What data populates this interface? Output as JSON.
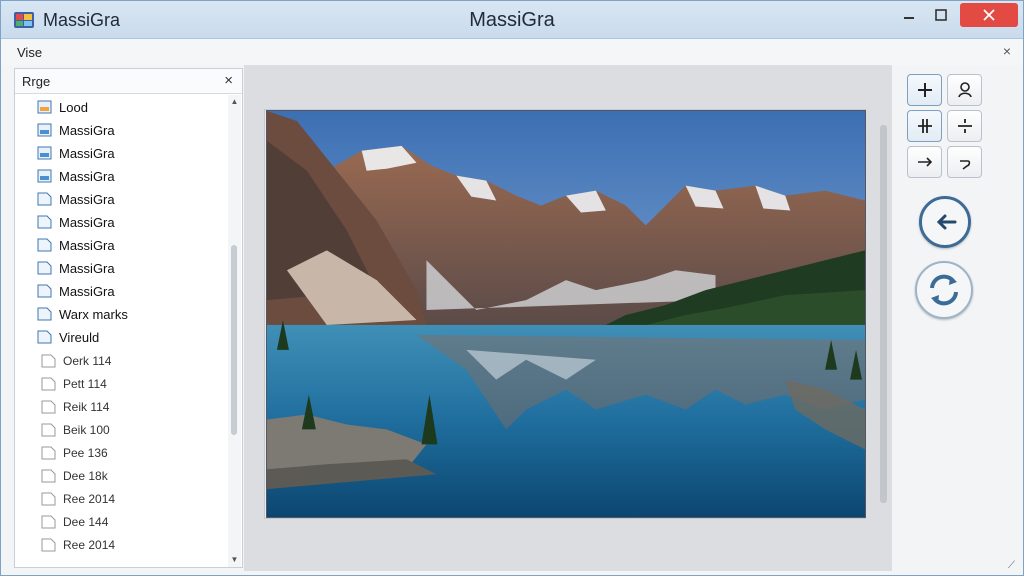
{
  "app": {
    "name": "MassiGra",
    "window_title": "MassiGra",
    "icon": "app-palette-icon"
  },
  "window_controls": {
    "minimize_icon": "minimize-icon",
    "maximize_icon": "maximize-icon",
    "close_icon": "close-icon",
    "close_color": "#e24a43"
  },
  "menubar": {
    "item": "Vise",
    "close_glyph": "×"
  },
  "sidebar": {
    "title": "Rrge",
    "close_glyph": "×",
    "items": [
      {
        "label": "Lood",
        "icon": "image-file-icon"
      },
      {
        "label": "MassiGra",
        "icon": "image-file-icon"
      },
      {
        "label": "MassiGra",
        "icon": "image-file-icon"
      },
      {
        "label": "MassiGra",
        "icon": "image-file-icon"
      },
      {
        "label": "MassiGra",
        "icon": "file-icon"
      },
      {
        "label": "MassiGra",
        "icon": "file-icon"
      },
      {
        "label": "MassiGra",
        "icon": "file-icon"
      },
      {
        "label": "MassiGra",
        "icon": "file-icon"
      },
      {
        "label": "MassiGra",
        "icon": "file-icon"
      },
      {
        "label": "Warx marks",
        "icon": "file-icon"
      },
      {
        "label": "Vireuld",
        "icon": "file-icon"
      }
    ],
    "subitems": [
      {
        "label": "Oerk 114",
        "icon": "blank-page-icon"
      },
      {
        "label": "Pett 114",
        "icon": "blank-page-icon"
      },
      {
        "label": "Reik 114",
        "icon": "blank-page-icon"
      },
      {
        "label": "Beik 100",
        "icon": "blank-page-icon"
      },
      {
        "label": "Pee 136",
        "icon": "blank-page-icon"
      },
      {
        "label": "Dee 18k",
        "icon": "blank-page-icon"
      },
      {
        "label": "Ree 2014",
        "icon": "blank-page-icon"
      },
      {
        "label": "Dee 144",
        "icon": "blank-page-icon"
      },
      {
        "label": "Ree 2014",
        "icon": "blank-page-icon"
      }
    ]
  },
  "viewer": {
    "image": "mountain-lake-photo"
  },
  "tools": {
    "buttons": [
      {
        "icon": "zoom-in-plus-icon"
      },
      {
        "icon": "person-icon"
      },
      {
        "icon": "move-cross-icon"
      },
      {
        "icon": "split-icon"
      },
      {
        "icon": "arrow-right-icon"
      },
      {
        "icon": "hook-arrow-icon"
      }
    ],
    "back_icon": "arrow-left-circle-icon",
    "refresh_icon": "refresh-circle-icon",
    "accent": "#3c6c96"
  }
}
